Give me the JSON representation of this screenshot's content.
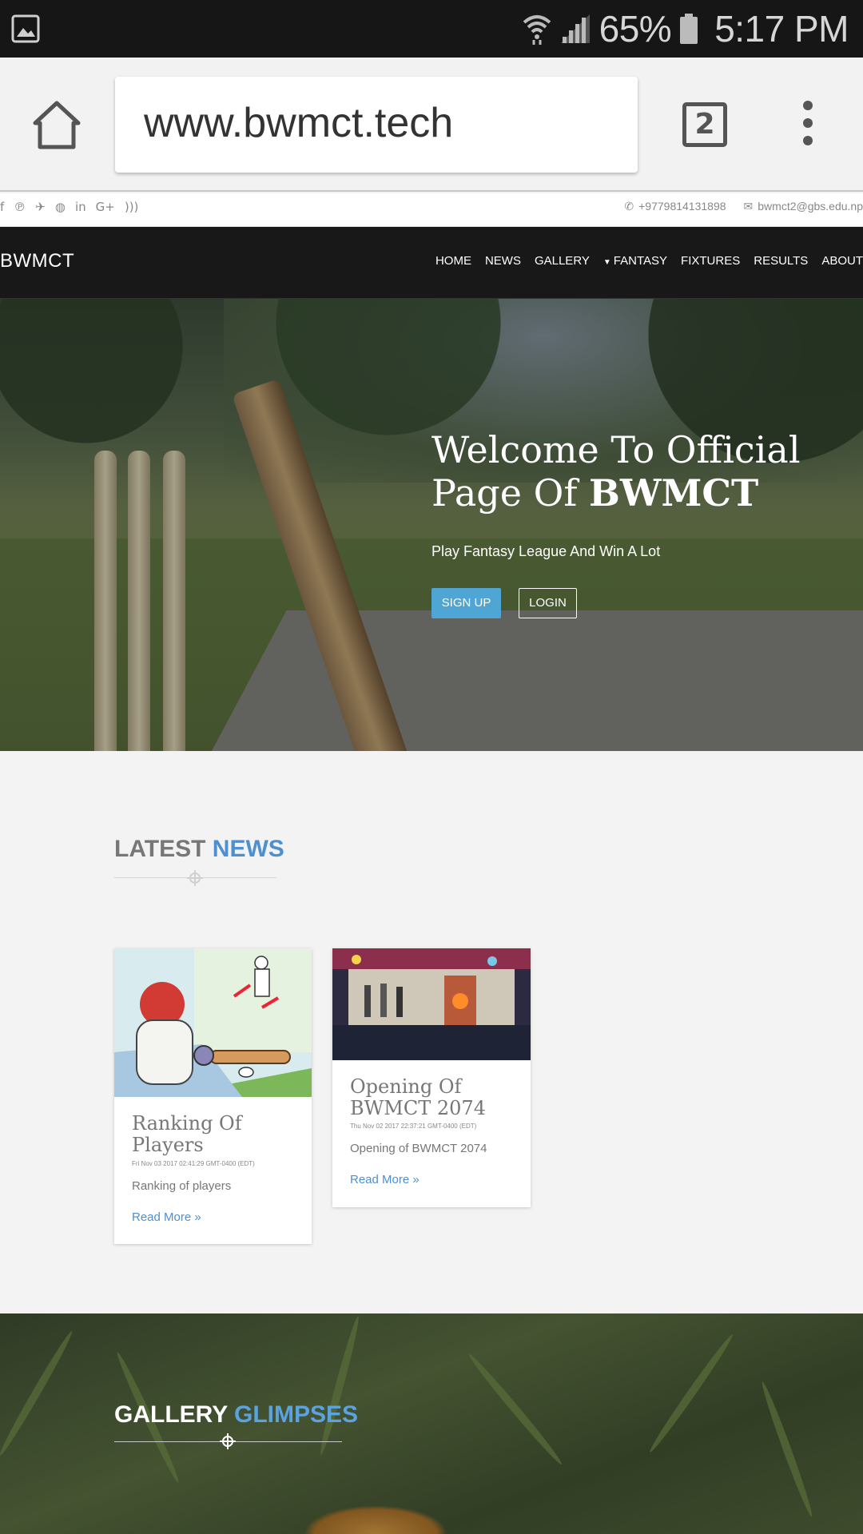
{
  "status_bar": {
    "battery_percent": "65%",
    "time": "5:17 PM"
  },
  "browser": {
    "url": "www.bwmct.tech",
    "tab_count": "2"
  },
  "topbar": {
    "social_icons": [
      "facebook-icon",
      "pinterest-icon",
      "twitter-icon",
      "dribbble-icon",
      "linkedin-icon",
      "google-plus-icon",
      "rss-icon"
    ],
    "phone": "+9779814131898",
    "email": "bwmct2@gbs.edu.np"
  },
  "navbar": {
    "brand": "BWMCT",
    "items": [
      "HOME",
      "NEWS",
      "GALLERY",
      "FANTASY",
      "FIXTURES",
      "RESULTS",
      "ABOUT"
    ]
  },
  "hero": {
    "title_line1": "Welcome To Official",
    "title_line2_prefix": "Page Of ",
    "title_line2_bold": "BWMCT",
    "subtitle": "Play Fantasy League And Win A Lot",
    "signup_label": "SIGN UP",
    "login_label": "LOGIN"
  },
  "news": {
    "title_plain": "LATEST ",
    "title_accent": "NEWS",
    "cards": [
      {
        "title": "Ranking Of Players",
        "date": "Fri Nov 03 2017 02:41:29 GMT-0400 (EDT)",
        "excerpt": "Ranking of players",
        "more": "Read More »"
      },
      {
        "title": "Opening Of BWMCT 2074",
        "date": "Thu Nov 02 2017 22:37:21 GMT-0400 (EDT)",
        "excerpt": "Opening of BWMCT 2074",
        "more": "Read More »"
      }
    ]
  },
  "gallery": {
    "title_plain": "GALLERY ",
    "title_accent": "GLIMPSES"
  },
  "colors": {
    "accent": "#4e8fcf",
    "signup": "#4fa6d5",
    "navbar": "#181818"
  }
}
